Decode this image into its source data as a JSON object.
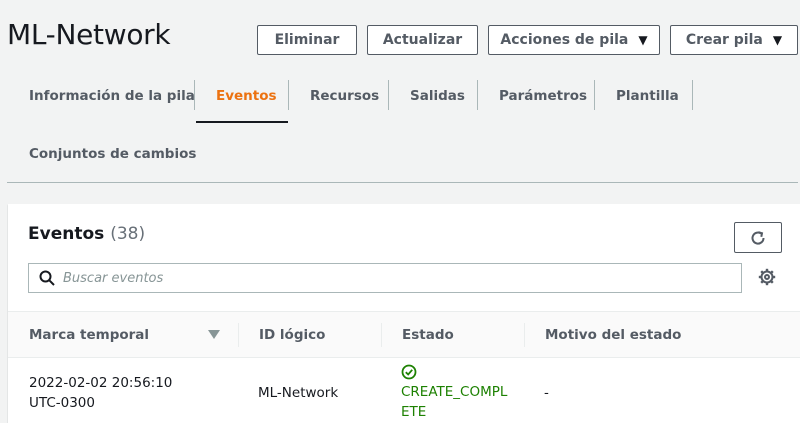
{
  "page": {
    "title": "ML-Network"
  },
  "actions": {
    "delete": "Eliminar",
    "update": "Actualizar",
    "stack_actions": "Acciones de pila",
    "create_stack": "Crear pila"
  },
  "tabs": [
    {
      "label": "Información de la pila"
    },
    {
      "label": "Eventos"
    },
    {
      "label": "Recursos"
    },
    {
      "label": "Salidas"
    },
    {
      "label": "Parámetros"
    },
    {
      "label": "Plantilla"
    },
    {
      "label": "Conjuntos de cambios"
    }
  ],
  "active_tab": "Eventos",
  "events": {
    "title": "Eventos",
    "count": "(38)",
    "search_placeholder": "Buscar eventos",
    "columns": [
      {
        "label": "Marca temporal"
      },
      {
        "label": "ID lógico"
      },
      {
        "label": "Estado"
      },
      {
        "label": "Motivo del estado"
      }
    ],
    "rows": [
      {
        "timestamp_date": "2022-02-02 20:56:10",
        "timestamp_tz": "UTC-0300",
        "logical_id": "ML-Network",
        "status_line1": "CREATE_COMPL",
        "status_line2": "ETE",
        "reason": "-"
      }
    ]
  },
  "colors": {
    "accent": "#ec7211",
    "success": "#1d8102",
    "text": "#16191f",
    "muted": "#545b64"
  },
  "icons": {
    "search": "search-icon",
    "refresh": "refresh-icon",
    "settings": "gear-icon",
    "status": "check-circle-icon",
    "sort": "sort-down-icon",
    "caret": "caret-down-icon"
  }
}
